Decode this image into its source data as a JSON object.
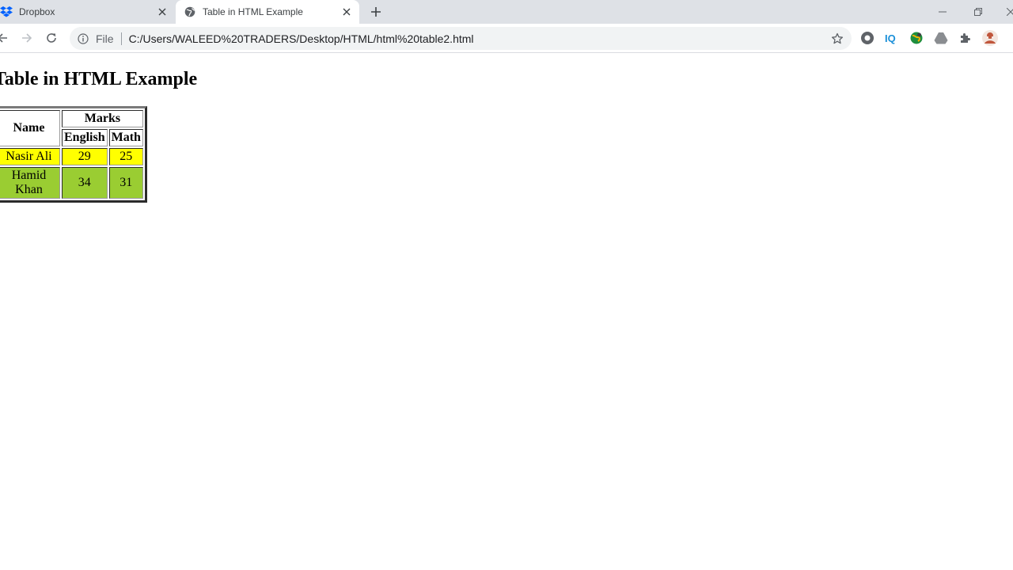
{
  "browser": {
    "tabs": [
      {
        "title": "Dropbox",
        "active": false,
        "icon": "dropbox-icon"
      },
      {
        "title": "Table in HTML Example",
        "active": true,
        "icon": "globe-icon"
      }
    ],
    "address_bar": {
      "scheme_label": "File",
      "url": "C:/Users/WALEED%20TRADERS/Desktop/HTML/html%20table2.html"
    },
    "extensions": [
      "circle-extension-icon",
      "iq-extension-icon",
      "globe-extension-icon",
      "drive-extension-icon",
      "puzzle-extensions-icon",
      "profile-avatar"
    ]
  },
  "page": {
    "heading": "Table in HTML Example",
    "table": {
      "headers": {
        "name": "Name",
        "group": "Marks",
        "sub": [
          "English",
          "Math"
        ]
      },
      "rows": [
        {
          "name": "Nasir Ali",
          "english": "29",
          "math": "25",
          "color": "#ffff00"
        },
        {
          "name": "Hamid Khan",
          "english": "34",
          "math": "31",
          "color": "#9acd32"
        }
      ]
    }
  },
  "colors": {
    "tabstrip": "#dee1e6",
    "omnibox": "#f1f3f4",
    "dropbox_blue": "#0061fe"
  }
}
